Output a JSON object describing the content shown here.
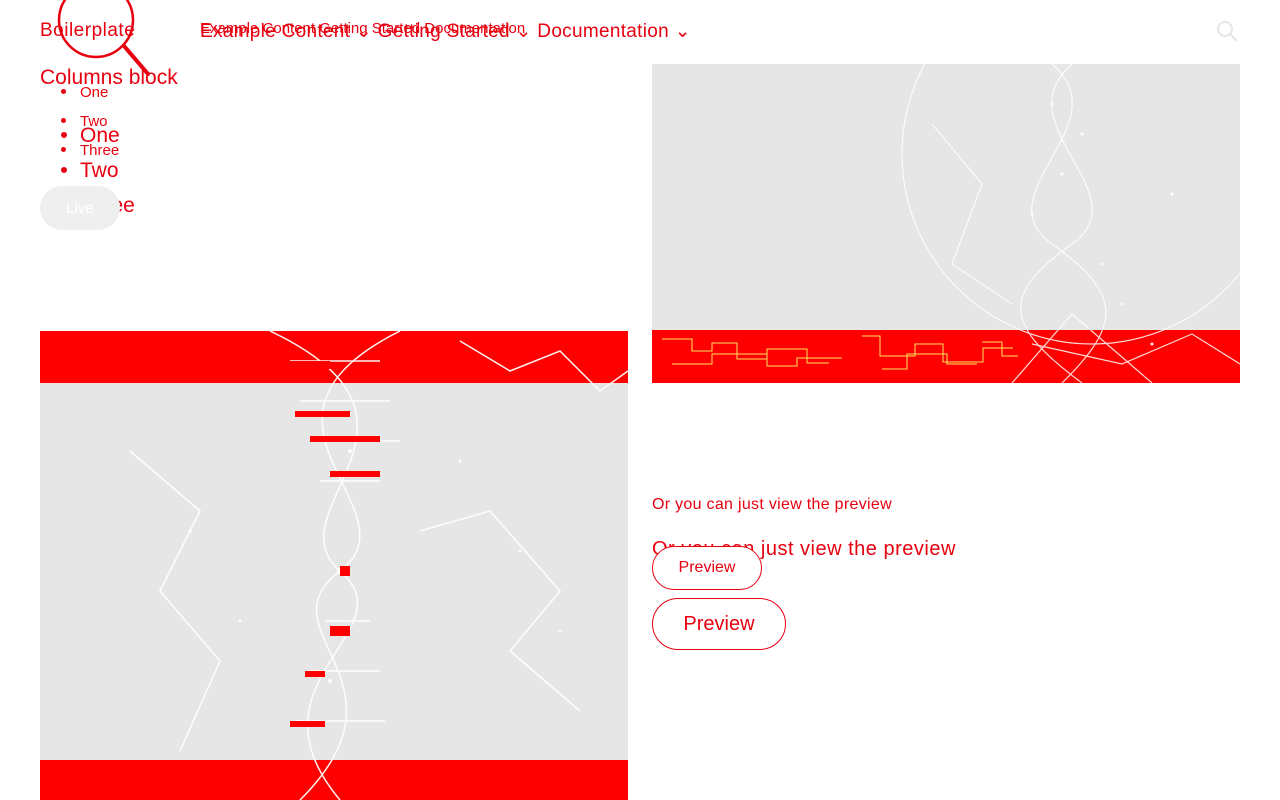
{
  "header": {
    "brand": "Boilerplate",
    "nav_small": "Example Content  Getting Started  Documentation",
    "nav_big": "Example Content ⌄  Getting Started ⌄  Documentation ⌄"
  },
  "columns": {
    "title": "Columns block",
    "list_small": [
      "One",
      "Two",
      "Three"
    ],
    "list_big": [
      "One",
      "Two",
      "Three"
    ],
    "live_button": "Live"
  },
  "preview": {
    "text_small": "Or you can just view the preview",
    "text_big": "Or you can just view the preview",
    "button_small": "Preview",
    "button_big": "Preview"
  },
  "icons": {
    "search": "search-icon",
    "magnifier": "magnifier-icon"
  },
  "colors": {
    "accent": "#e8000f",
    "image_bg": "#e6e6e6",
    "button_bg": "#efefef"
  }
}
